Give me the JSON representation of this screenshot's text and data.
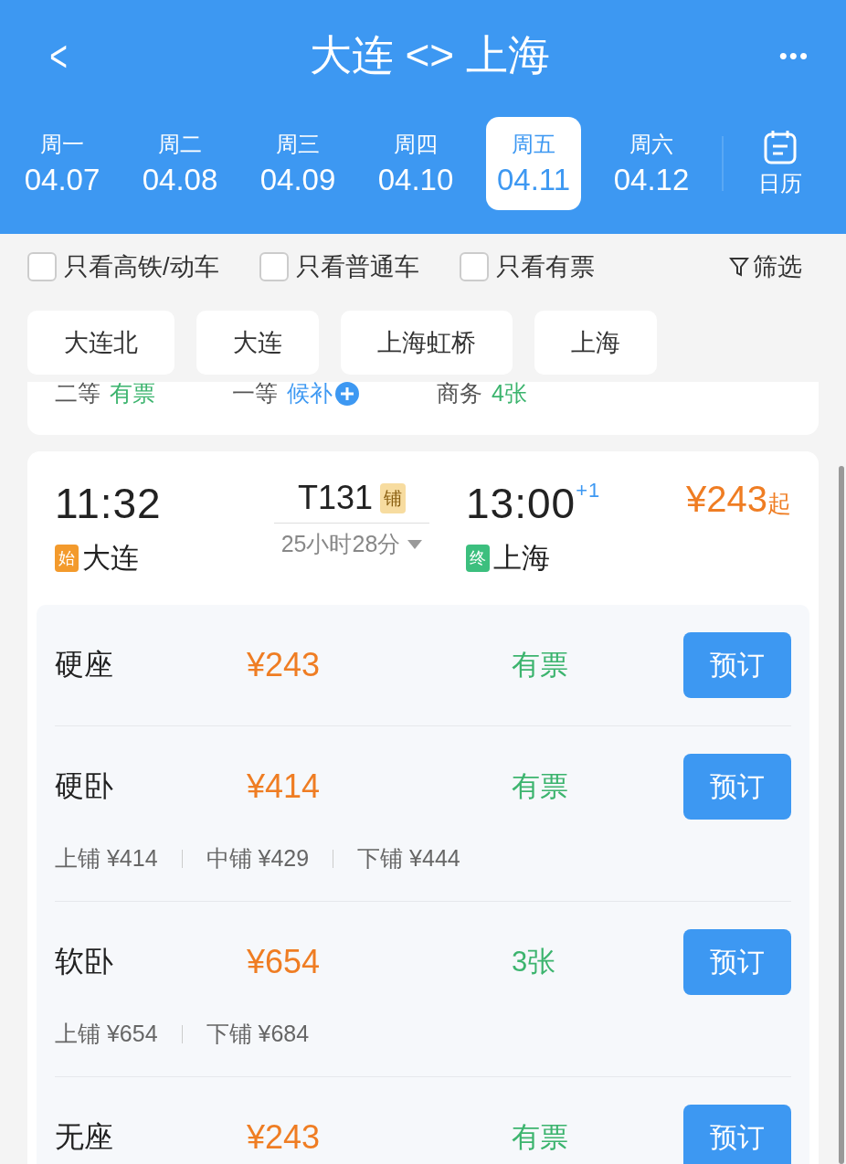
{
  "header": {
    "back": "<",
    "title": "大连 <> 上海",
    "more": "•••"
  },
  "dates": [
    {
      "weekday": "周一",
      "date": "04.07",
      "selected": false
    },
    {
      "weekday": "周二",
      "date": "04.08",
      "selected": false
    },
    {
      "weekday": "周三",
      "date": "04.09",
      "selected": false
    },
    {
      "weekday": "周四",
      "date": "04.10",
      "selected": false
    },
    {
      "weekday": "周五",
      "date": "04.11",
      "selected": true
    },
    {
      "weekday": "周六",
      "date": "04.12",
      "selected": false
    }
  ],
  "calendar": {
    "label": "日历"
  },
  "filters": [
    {
      "label": "只看高铁/动车",
      "checked": false
    },
    {
      "label": "只看普通车",
      "checked": false
    },
    {
      "label": "只看有票",
      "checked": false
    }
  ],
  "filter_button": "筛选",
  "stations": [
    "大连北",
    "大连",
    "上海虹桥",
    "上海"
  ],
  "previous_card": {
    "classes": [
      {
        "name": "二等",
        "status": "有票",
        "kind": "available"
      },
      {
        "name": "一等",
        "status": "候补",
        "kind": "waitlist"
      },
      {
        "name": "商务",
        "status": "4张",
        "kind": "available"
      }
    ]
  },
  "train": {
    "depart_time": "11:32",
    "number": "T131",
    "badge": "铺",
    "arrive_time": "13:00",
    "day_offset": "+1",
    "price": "¥243",
    "price_suffix": "起",
    "origin_tag": "始",
    "origin": "大连",
    "duration": "25小时28分",
    "dest_tag": "终",
    "destination": "上海"
  },
  "seats": [
    {
      "name": "硬座",
      "price": "¥243",
      "availability": "有票",
      "button": "预订"
    },
    {
      "name": "硬卧",
      "price": "¥414",
      "availability": "有票",
      "button": "预订",
      "berths": [
        "上铺 ¥414",
        "中铺 ¥429",
        "下铺 ¥444"
      ]
    },
    {
      "name": "软卧",
      "price": "¥654",
      "availability": "3张",
      "button": "预订",
      "berths": [
        "上铺 ¥654",
        "下铺 ¥684"
      ]
    },
    {
      "name": "无座",
      "price": "¥243",
      "availability": "有票",
      "button": "预订"
    }
  ]
}
